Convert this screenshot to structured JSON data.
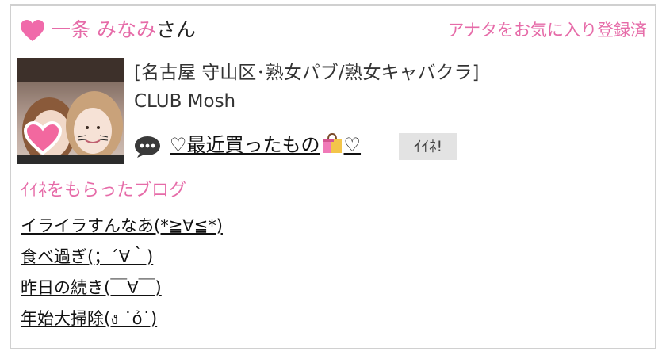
{
  "header": {
    "name": "一条 みなみ",
    "name_suffix": "さん",
    "favorite_status": "アナタをお気に入り登録済"
  },
  "profile": {
    "area": "[名古屋 守山区･熟女パブ/熟女キャバクラ]",
    "shop": "CLUB Mosh"
  },
  "post": {
    "title_before": "♡最近買ったもの",
    "title_after": "♡",
    "iine_label": "ｲｲﾈ!"
  },
  "liked_blogs": {
    "title": "ｲｲﾈをもらったブログ",
    "items": [
      "イライラすんなあ(*≧∀≦*)",
      "食べ過ぎ(；´∀｀)",
      "昨日の続き(￣∀￣)",
      "年始大掃除(ง ˙ỏ˙)"
    ]
  },
  "colors": {
    "accent_pink": "#e66ba8",
    "border": "#d0d0d0",
    "button_bg": "#e3e3e3"
  },
  "icons": [
    "heart-icon",
    "speech-bubble-icon",
    "shopping-bag-icon"
  ]
}
